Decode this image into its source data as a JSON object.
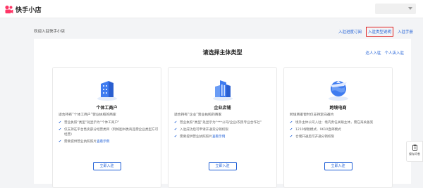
{
  "header": {
    "logo_text": "快手小店",
    "brand_color": "#fe3666"
  },
  "welcome_text": "欢迎入驻快手小店",
  "top_links": [
    {
      "label": "入驻进度订阅"
    },
    {
      "label": "入驻类型说明"
    },
    {
      "label": "入驻手册"
    }
  ],
  "panel": {
    "title": "请选择主体类型",
    "links": [
      {
        "label": "达人入驻"
      },
      {
        "label": "个人店入驻"
      }
    ]
  },
  "cards": [
    {
      "icon": "individual-business-icon",
      "title": "个体工商户",
      "subtitle": "适合持有“个体工商户”营业执照的商家",
      "items": [
        {
          "text": "营业执照“类型”处显示为“个体工商户”",
          "link": ""
        },
        {
          "text": "仅支持在平台售卖部分经营类目（例如图书类商品需企业类型方可经营）",
          "link": ""
        },
        {
          "text": "需要提供营业执照照片",
          "link": "查看示例"
        }
      ],
      "button": "立即入驻"
    },
    {
      "icon": "enterprise-store-icon",
      "title": "企业店铺",
      "subtitle": "适合持有“企业”营业执照的商家",
      "items": [
        {
          "text": "营业执照“类型”处显示为“***公司/企业/农民专业合作社”",
          "link": ""
        },
        {
          "text": "入驻成功后可申请开通货分销权限",
          "link": ""
        },
        {
          "text": "需要提供营业执照照片",
          "link": "查看示例"
        }
      ],
      "button": "立即入驻"
    },
    {
      "icon": "cross-border-icon",
      "title": "跨境电商",
      "subtitle": "跨境商家暂时仅支持定向邀约",
      "items": [
        {
          "text": "境外主体公司入驻：境内责任关联主体，需在海关备案",
          "link": ""
        },
        {
          "text": "1210保税模式、9610直邮模式",
          "link": ""
        },
        {
          "text": "仓储开通后可开通分销权限",
          "link": ""
        }
      ],
      "button": "立即入驻"
    }
  ],
  "side_widget": {
    "label": "保存问卷",
    "icon": "clipboard-icon"
  }
}
